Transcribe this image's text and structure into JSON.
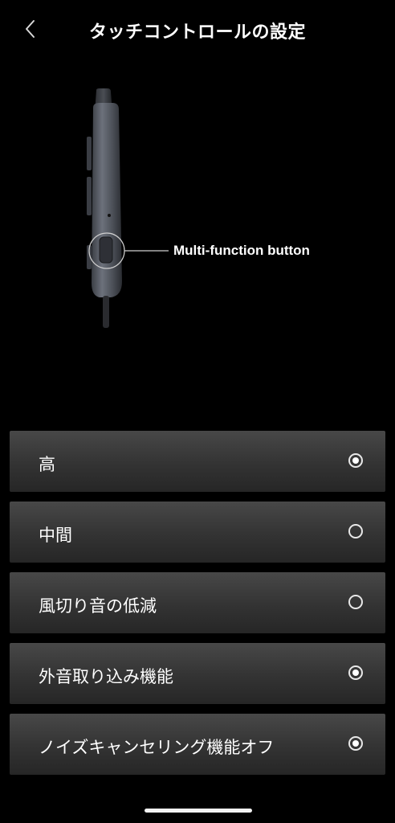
{
  "header": {
    "title": "タッチコントロールの設定"
  },
  "illustration": {
    "callout_label": "Multi-function button"
  },
  "options": [
    {
      "label": "高",
      "selected": true
    },
    {
      "label": "中間",
      "selected": false
    },
    {
      "label": "風切り音の低減",
      "selected": false
    },
    {
      "label": "外音取り込み機能",
      "selected": true
    },
    {
      "label": "ノイズキャンセリング機能オフ",
      "selected": true
    }
  ],
  "colors": {
    "background": "#000000",
    "option_top": "#484848",
    "option_bottom": "#262626",
    "text": "#ffffff"
  },
  "icons": {
    "back": "chevron-left-icon",
    "radio_on": "radio-selected-icon",
    "radio_off": "radio-unselected-icon"
  }
}
